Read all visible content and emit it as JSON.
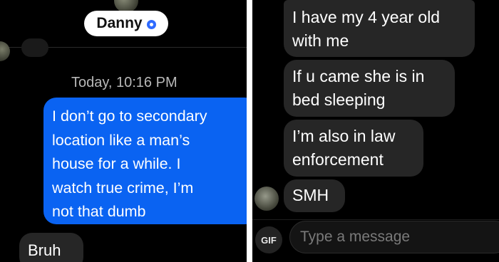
{
  "left_panel": {
    "contact": {
      "name": "Danny",
      "verified_icon": "verified-badge-icon"
    },
    "timestamp": "Today, 10:16 PM",
    "outgoing_message": {
      "lines": [
        "I don’t go to secondary",
        "location like a man’s",
        "house for a while. I",
        "watch true crime, I’m",
        "not that dumb"
      ],
      "color": "#0a63f2"
    },
    "incoming_message": "Bruh"
  },
  "right_panel": {
    "messages": [
      {
        "lines": [
          "I have my 4 year old",
          "with me"
        ]
      },
      {
        "lines": [
          "If u came she is in",
          "bed sleeping"
        ]
      },
      {
        "lines": [
          "I’m also in law",
          "enforcement"
        ]
      },
      {
        "lines": [
          "SMH"
        ]
      }
    ],
    "composer": {
      "gif_label": "GIF",
      "placeholder": "Type a message"
    }
  },
  "colors": {
    "background": "#000000",
    "incoming_bubble": "#262626",
    "accent": "#0a63f2"
  }
}
